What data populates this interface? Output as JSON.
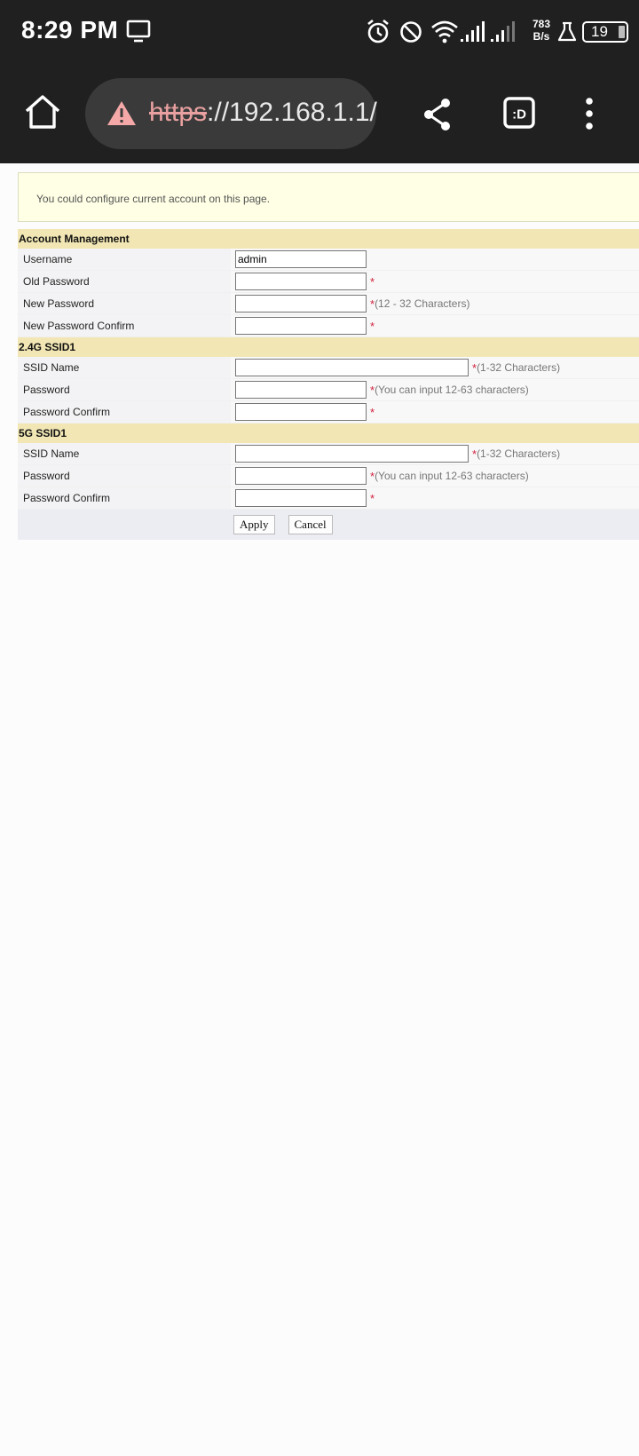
{
  "status_bar": {
    "time": "8:29 PM",
    "net_speed_value": "783",
    "net_speed_unit": "B/s",
    "battery_level": "19",
    "icons": [
      "tv-icon",
      "alarm-icon",
      "do-not-disturb-icon",
      "wifi-icon",
      "signal-icon",
      "signal-icon",
      "flask-icon",
      "battery-icon"
    ]
  },
  "browser": {
    "url_scheme": "https",
    "url_rest": "://192.168.1.1/",
    "security_icon": "warning-icon",
    "buttons": [
      "home-icon",
      "share-icon",
      "tabs-icon",
      "more-vert-icon"
    ],
    "tabs_label": ":D"
  },
  "page": {
    "info_text": "You could configure current account on this page.",
    "required_mark": "*",
    "sections": {
      "account": {
        "title": "Account Management",
        "username_label": "Username",
        "username_value": "admin",
        "old_password_label": "Old Password",
        "new_password_label": "New Password",
        "new_password_hint": "(12 - 32 Characters)",
        "new_password_confirm_label": "New Password Confirm"
      },
      "ssid_24g": {
        "title": "2.4G SSID1",
        "ssid_name_label": "SSID Name",
        "ssid_name_hint": "(1-32 Characters)",
        "password_label": "Password",
        "password_hint": "(You can input 12-63 characters)",
        "password_confirm_label": "Password Confirm"
      },
      "ssid_5g": {
        "title": "5G SSID1",
        "ssid_name_label": "SSID Name",
        "ssid_name_hint": "(1-32 Characters)",
        "password_label": "Password",
        "password_hint": "(You can input 12-63 characters)",
        "password_confirm_label": "Password Confirm"
      }
    },
    "apply_label": "Apply",
    "cancel_label": "Cancel"
  },
  "colors": {
    "chrome_bg": "#202020",
    "section_header_bg": "#f1e6b4",
    "info_box_bg": "#ffffe5",
    "required_mark": "#d21f3c",
    "warning_icon": "#f4a9a8"
  }
}
